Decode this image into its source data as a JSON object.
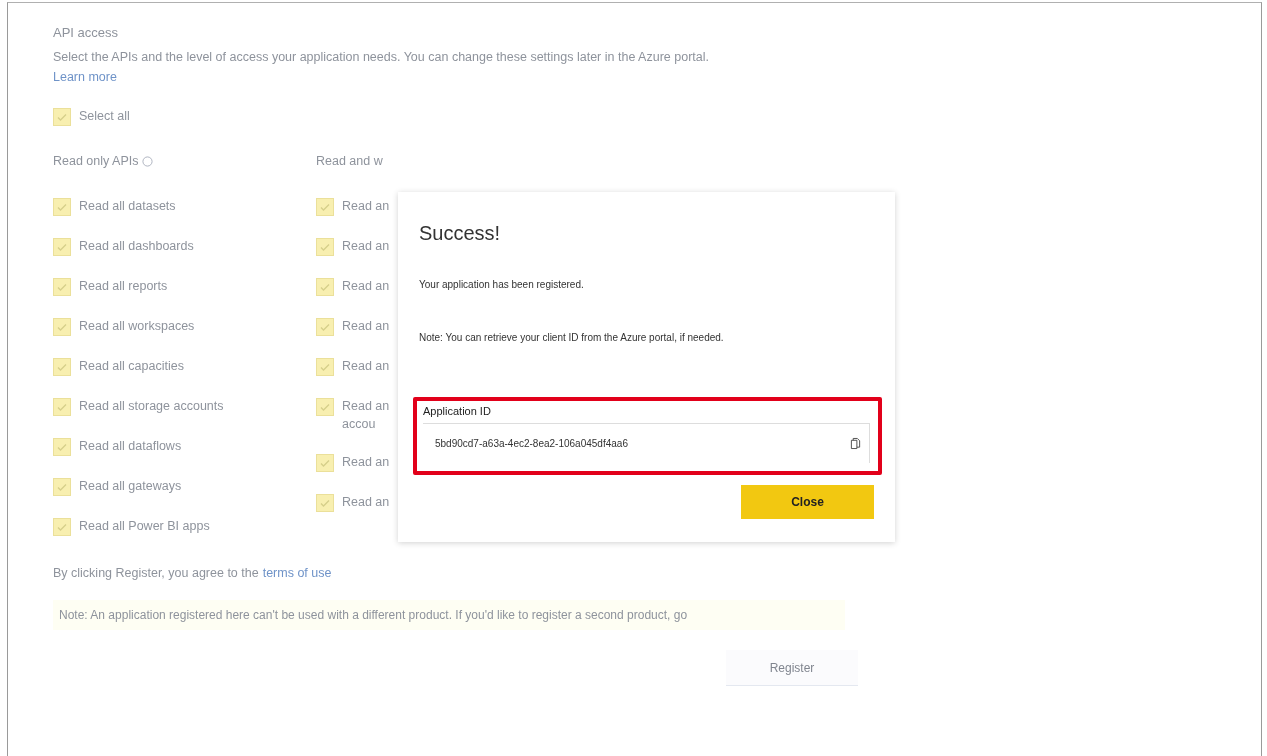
{
  "section": {
    "title": "API access",
    "description": "Select the APIs and the level of access your application needs. You can change these settings later in the Azure portal.",
    "learn_more": "Learn more"
  },
  "select_all": {
    "label": "Select all",
    "checked": true
  },
  "columns": [
    {
      "heading": "Read only APIs",
      "info": true,
      "items": [
        {
          "label": "Read all datasets",
          "checked": true
        },
        {
          "label": "Read all dashboards",
          "checked": true
        },
        {
          "label": "Read all reports",
          "checked": true
        },
        {
          "label": "Read all workspaces",
          "checked": true
        },
        {
          "label": "Read all capacities",
          "checked": true
        },
        {
          "label": "Read all storage accounts",
          "checked": true
        },
        {
          "label": "Read all dataflows",
          "checked": true
        },
        {
          "label": "Read all gateways",
          "checked": true
        },
        {
          "label": "Read all Power BI apps",
          "checked": true
        }
      ]
    },
    {
      "heading": "Read and w",
      "info": false,
      "items": [
        {
          "label": "Read an",
          "checked": true
        },
        {
          "label": "Read an",
          "checked": true
        },
        {
          "label": "Read an",
          "checked": true
        },
        {
          "label": "Read an",
          "checked": true
        },
        {
          "label": "Read an",
          "checked": true
        },
        {
          "label": "Read an",
          "continuation": "accou",
          "checked": true
        },
        {
          "label": "Read an",
          "checked": true
        },
        {
          "label": "Read an",
          "checked": true
        }
      ]
    }
  ],
  "terms": {
    "text": "By clicking Register, you agree to the",
    "link": "terms of use"
  },
  "note": "Note: An application registered here can't be used with a different product. If you'd like to register a second product, go",
  "register_button": "Register",
  "dialog": {
    "title": "Success!",
    "message": "Your application has been registered.",
    "note": "Note: You can retrieve your client ID from the Azure portal, if needed.",
    "field_label": "Application ID",
    "field_value": "5bd90cd7-a63a-4ec2-8ea2-106a045df4aa6",
    "highlighted": true,
    "close_button": "Close"
  }
}
